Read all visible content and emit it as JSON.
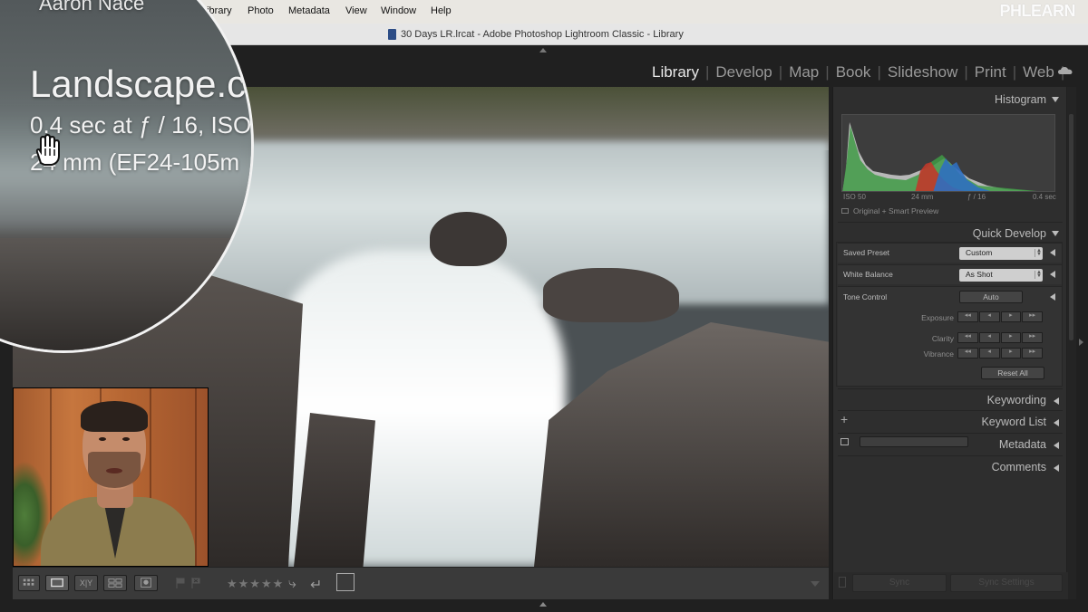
{
  "menubar": {
    "items": [
      "Library",
      "Photo",
      "Metadata",
      "View",
      "Window",
      "Help"
    ],
    "watermark": "PHLEARN"
  },
  "window": {
    "title": "30 Days LR.lrcat - Adobe Photoshop Lightroom Classic - Library"
  },
  "modules": [
    "Library",
    "Develop",
    "Map",
    "Book",
    "Slideshow",
    "Print",
    "Web"
  ],
  "active_module": "Library",
  "magnifier": {
    "top_text": "Aaron Nace",
    "title": "Landscape.c",
    "exposure": "0.4 sec at ƒ / 16, ISO",
    "lens": "24 mm (EF24-105m"
  },
  "histogram": {
    "header": "Histogram",
    "iso": "ISO 50",
    "focal": "24 mm",
    "aperture": "ƒ / 16",
    "shutter": "0.4 sec",
    "preview": "Original + Smart Preview"
  },
  "quick_develop": {
    "header": "Quick Develop",
    "saved_preset_label": "Saved Preset",
    "saved_preset_value": "Custom",
    "white_balance_label": "White Balance",
    "white_balance_value": "As Shot",
    "tone_control_label": "Tone Control",
    "auto_label": "Auto",
    "exposure_label": "Exposure",
    "clarity_label": "Clarity",
    "vibrance_label": "Vibrance",
    "reset_label": "Reset All"
  },
  "panels": {
    "keywording": "Keywording",
    "keyword_list": "Keyword List",
    "metadata": "Metadata",
    "comments": "Comments"
  },
  "sync": {
    "sync_label": "Sync",
    "sync_settings_label": "Sync Settings"
  },
  "toolbar": {
    "compare_label": "X|Y",
    "stars": "★★★★★"
  },
  "colors": {
    "accent_active": "#e8e8e8",
    "panel_bg": "#2e2e2e",
    "histogram_red": "#c0392b",
    "histogram_green": "#3f9a45",
    "histogram_blue": "#2f6fc0"
  }
}
